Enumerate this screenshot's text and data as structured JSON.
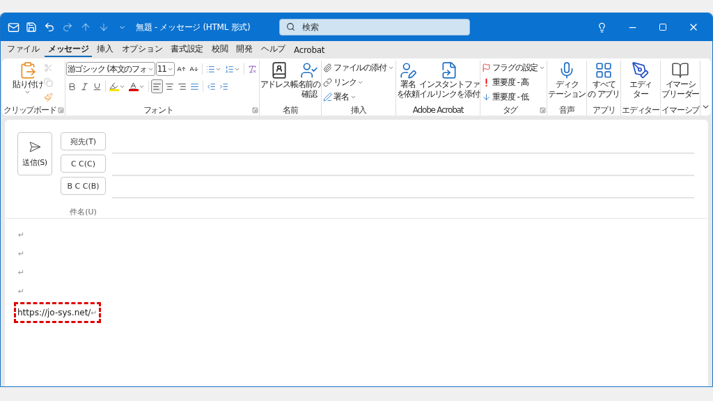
{
  "window": {
    "title": "無題 - メッセージ (HTML 形式)"
  },
  "quick_access": [
    {
      "disabled": false
    },
    {
      "disabled": false
    },
    {
      "disabled": true
    },
    {
      "disabled": true
    },
    {
      "disabled": true
    },
    {
      "disabled": false
    }
  ],
  "search": {
    "placeholder": "検索"
  },
  "menu_tabs": [
    {
      "label": "ファイル",
      "selected": false
    },
    {
      "label": "メッセージ",
      "selected": true
    },
    {
      "label": "挿入",
      "selected": false
    },
    {
      "label": "オプション",
      "selected": false
    },
    {
      "label": "書式設定",
      "selected": false
    },
    {
      "label": "校閲",
      "selected": false
    },
    {
      "label": "開発",
      "selected": false
    },
    {
      "label": "ヘルプ",
      "selected": false
    },
    {
      "label": "Acrobat",
      "selected": false
    }
  ],
  "ribbon": {
    "groups": [
      {
        "label": "クリップボード",
        "launcher": true,
        "columns": [
          [
            {
              "kind": "large",
              "lines": [
                "貼り付け"
              ],
              "dropdown": true
            }
          ],
          [
            {
              "kind": "tool",
              "disabled": true
            },
            {
              "kind": "tool",
              "disabled": true
            },
            {
              "kind": "tool",
              "disabled": false
            }
          ]
        ]
      },
      {
        "label": "フォント",
        "launcher": true,
        "rows": [
          [
            {
              "kind": "select",
              "value": "游ゴシック (本文のフォ"
            },
            {
              "kind": "select",
              "value": "11"
            },
            {
              "kind": "tool"
            },
            {
              "kind": "tool"
            },
            {
              "kind": "tool",
              "dropdown": true
            },
            {
              "kind": "tool",
              "dropdown": true
            },
            {
              "kind": "tool"
            }
          ],
          [
            {
              "kind": "tool"
            },
            {
              "kind": "tool"
            },
            {
              "kind": "tool"
            },
            {
              "kind": "tool",
              "dropdown": true
            },
            {
              "kind": "tool",
              "dropdown": true
            },
            {
              "kind": "tool",
              "selected": true
            },
            {
              "kind": "tool",
              "selected": false
            },
            {
              "kind": "tool",
              "selected": false
            },
            {
              "kind": "tool",
              "selected": false
            },
            {
              "kind": "tool"
            },
            {
              "kind": "tool"
            }
          ]
        ]
      },
      {
        "label": "名前",
        "launcher": false,
        "columns": [
          [
            {
              "kind": "large",
              "lines": [
                "アドレス帳"
              ]
            }
          ],
          [
            {
              "kind": "large",
              "lines": [
                "名前の",
                "確認"
              ]
            }
          ]
        ]
      },
      {
        "label": "挿入",
        "launcher": false,
        "columns": [
          [
            {
              "kind": "small",
              "label": "ファイルの添付",
              "dropdown": true
            },
            {
              "kind": "small",
              "label": "リンク",
              "dropdown": true
            },
            {
              "kind": "small",
              "label": "署名",
              "dropdown": true
            }
          ]
        ]
      },
      {
        "label": "Adobe Acrobat",
        "launcher": false,
        "columns": [
          [
            {
              "kind": "large",
              "lines": [
                "署名",
                "を依頼"
              ]
            }
          ],
          [
            {
              "kind": "large",
              "lines": [
                "インスタントファ",
                "イルリンクを添付"
              ]
            }
          ]
        ]
      },
      {
        "label": "タグ",
        "launcher": true,
        "columns": [
          [
            {
              "kind": "small",
              "label": "フラグの設定",
              "dropdown": true
            },
            {
              "kind": "small",
              "label": "重要度 - 高",
              "dropdown": false
            },
            {
              "kind": "small",
              "label": "重要度 - 低",
              "dropdown": false
            }
          ]
        ]
      },
      {
        "label": "音声",
        "launcher": false,
        "columns": [
          [
            {
              "kind": "large",
              "lines": [
                "ディク",
                "テーション"
              ]
            }
          ]
        ]
      },
      {
        "label": "アプリ",
        "launcher": false,
        "columns": [
          [
            {
              "kind": "large",
              "lines": [
                "すべて",
                "の アプリ"
              ]
            }
          ]
        ]
      },
      {
        "label": "エディター",
        "launcher": false,
        "columns": [
          [
            {
              "kind": "large",
              "lines": [
                "エディ",
                "ター"
              ]
            }
          ]
        ]
      },
      {
        "label": "イマーシブ",
        "launcher": false,
        "columns": [
          [
            {
              "kind": "large",
              "lines": [
                "イマーシ",
                "ブリーダー"
              ]
            }
          ]
        ]
      }
    ]
  },
  "compose": {
    "send_button": "送信(S)",
    "address_fields": [
      {
        "label": "宛先(T)"
      },
      {
        "label": "C C(C)"
      },
      {
        "label": "B C C(B)"
      }
    ],
    "subject_label": "件名(U)"
  },
  "body": {
    "lines": [
      {
        "mark": "↵",
        "highlighted": false
      },
      {
        "mark": "↵",
        "highlighted": false
      },
      {
        "mark": "↵",
        "highlighted": false
      },
      {
        "mark": "↵",
        "highlighted": false
      },
      {
        "text": "https://jo-sys.net/",
        "mark": "↵",
        "highlighted": true
      }
    ]
  }
}
